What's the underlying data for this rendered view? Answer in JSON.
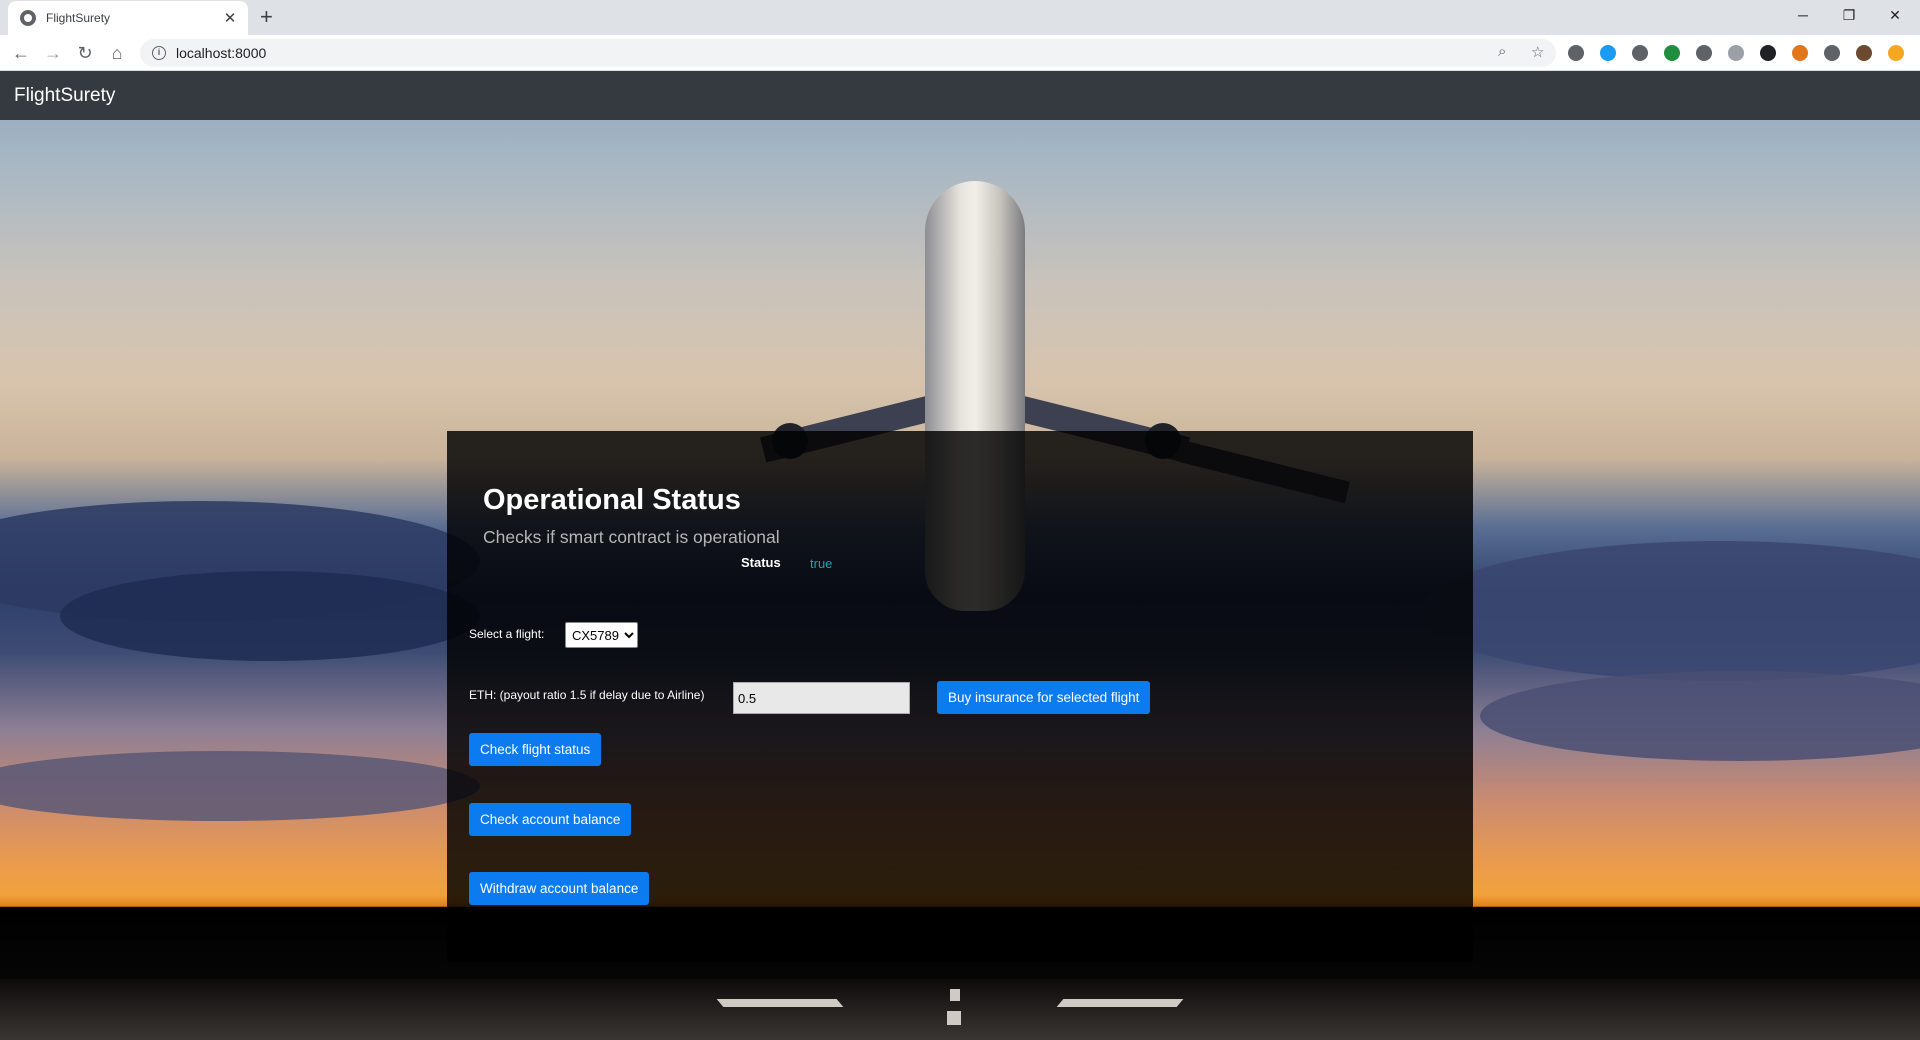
{
  "browser": {
    "tab_title": "FlightSurety",
    "tab_close": "✕",
    "new_tab": "+",
    "url": "localhost:8000",
    "window_controls": {
      "minimize": "─",
      "restore": "❐",
      "close": "✕"
    },
    "nav": {
      "back": "←",
      "forward": "→",
      "reload": "↻",
      "home": "⌂"
    },
    "omnibox_icons": {
      "zoom": "⌕",
      "bookmark": "☆"
    },
    "extension_colors": [
      "#5f6368",
      "#1a9af2",
      "#5f6368",
      "#1e8e3e",
      "#5f6368",
      "#9aa0a6",
      "#202124",
      "#e2761b",
      "#5f6368",
      "#6b4a2f",
      "#f5a623"
    ]
  },
  "app": {
    "brand": "FlightSurety"
  },
  "operational": {
    "title": "Operational Status",
    "subtitle": "Checks if smart contract is operational",
    "status_label": "Status",
    "status_value": "true"
  },
  "flight_select": {
    "label": "Select a flight:",
    "selected": "CX5789"
  },
  "insurance": {
    "label": "ETH: (payout ratio 1.5 if delay due to Airline)",
    "amount": "0.5",
    "buy_label": "Buy insurance for selected flight"
  },
  "actions": {
    "check_status": "Check flight status",
    "check_balance": "Check account balance",
    "withdraw": "Withdraw account balance"
  },
  "colors": {
    "navbar": "#343a40",
    "primary_button": "#0d7bf0",
    "status_true": "#17a2b8"
  }
}
